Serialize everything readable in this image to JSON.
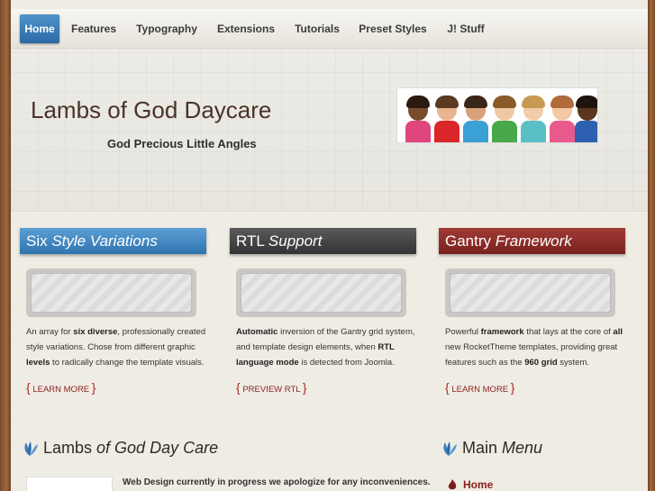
{
  "nav": {
    "items": [
      {
        "label": "Home",
        "active": true
      },
      {
        "label": "Features"
      },
      {
        "label": "Typography"
      },
      {
        "label": "Extensions"
      },
      {
        "label": "Tutorials"
      },
      {
        "label": "Preset Styles"
      },
      {
        "label": "J! Stuff"
      }
    ]
  },
  "header": {
    "title": "Lambs of God Daycare",
    "tagline": "God Precious Little Angles"
  },
  "features": [
    {
      "title_plain": "Six ",
      "title_italic": "Style Variations",
      "color": "#3f86c0",
      "desc_parts": [
        "An array for ",
        "six diverse",
        ", professionally created style variations. Chose from different graphic ",
        "levels",
        " to radically change the template visuals."
      ],
      "link": "LEARN MORE"
    },
    {
      "title_plain": "RTL ",
      "title_italic": "Support",
      "color": "#454545",
      "desc_parts": [
        "",
        "Automatic",
        " inversion of the Gantry grid system, and template design elements, when ",
        "RTL language mode",
        " is detected from Joomla."
      ],
      "link": "PREVIEW RTL"
    },
    {
      "title_plain": "Gantry ",
      "title_italic": "Framework",
      "color": "#8a2a26",
      "desc_parts": [
        "Powerful ",
        "framework",
        " that lays at the core of ",
        "all",
        " new RocketTheme templates, providing great features such as the ",
        "960 grid",
        " system."
      ],
      "link": "LEARN MORE"
    }
  ],
  "content": {
    "heading_plain": "Lambs ",
    "heading_italic": "of God Day Care",
    "notice": "Web Design currently in progress we apologize for any inconveniences."
  },
  "sidebar": {
    "heading_plain": "Main ",
    "heading_italic": "Menu",
    "menu_item": "Home"
  },
  "icons": {
    "leaf": "leaf-icon",
    "flame": "flame-icon"
  }
}
